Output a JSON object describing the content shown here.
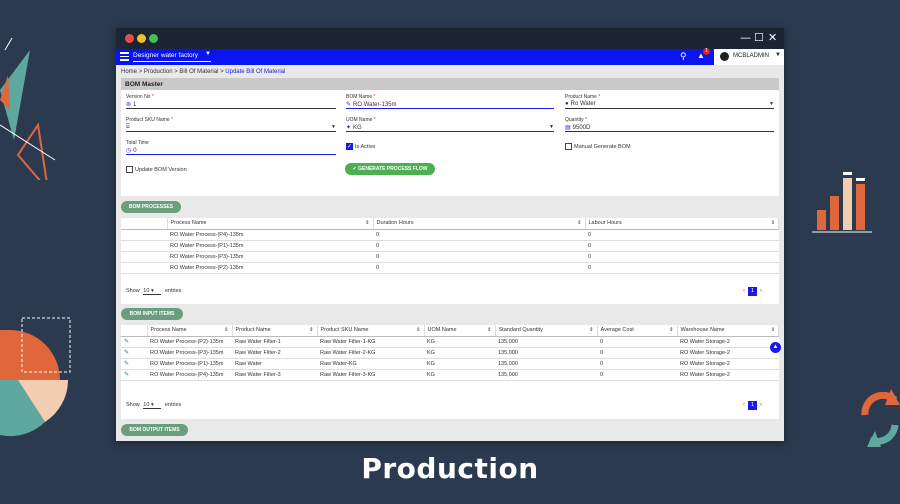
{
  "caption": "Production",
  "app": {
    "company_select": "Designer water factory",
    "notification_count": "1",
    "user_name": "MCBLADMIN"
  },
  "breadcrumb": {
    "home": "Home",
    "sep": ">",
    "production": "Production",
    "bom": "Bill Of Material",
    "current": "Update Bill Of Material"
  },
  "bom_master": {
    "title": "BOM Master",
    "version_no": {
      "label": "Version No",
      "value": "1"
    },
    "bom_name": {
      "label": "BOM Name",
      "value": "RO Water-135m"
    },
    "product_name": {
      "label": "Product Name",
      "value": "Ro Water"
    },
    "product_sku": {
      "label": "Product SKU Name",
      "value": ""
    },
    "uom_name": {
      "label": "UOM Name",
      "value": "KG"
    },
    "quantity": {
      "label": "Quantity",
      "value": "9500D"
    },
    "total_time": {
      "label": "Total Time",
      "value": "0"
    },
    "is_active": "Is Active",
    "manual_generate": "Manual Generate BOM",
    "update_version": "Update BOM Version",
    "generate_button": "GENERATE PROCESS FLOW"
  },
  "bom_processes": {
    "button": "BOM PROCESSES",
    "headers": [
      "Process Name",
      "Duration Hours",
      "Labour Hours"
    ],
    "rows": [
      [
        "RO Water Process-(P4)-135m",
        "0",
        "0"
      ],
      [
        "RO Water Process-(P1)-135m",
        "0",
        "0"
      ],
      [
        "RO Water Process-(P3)-135m",
        "0",
        "0"
      ],
      [
        "RO Water Process-(P2)-135m",
        "0",
        "0"
      ]
    ],
    "show": "Show",
    "entries_value": "10",
    "entries": "entries",
    "page": "1"
  },
  "bom_input": {
    "button": "BOM INPUT ITEMS",
    "headers": [
      "Process Name",
      "Product Name",
      "Product SKU Name",
      "UOM Name",
      "Standard Quantity",
      "Average Cost",
      "Warehouse Name"
    ],
    "rows": [
      [
        "RO Water Process-(P2)-135m",
        "Raw Water Filter-1",
        "Raw Water Filter-1-KG",
        "KG",
        "135,000",
        "0",
        "RO Water Storage-2"
      ],
      [
        "RO Water Process-(P3)-135m",
        "Raw Water Filter-2",
        "Raw Water Filter-2-KG",
        "KG",
        "135,000",
        "0",
        "RO Water Storage-2"
      ],
      [
        "RO Water Process-(P1)-135m",
        "Raw Water",
        "Raw Water-KG",
        "KG",
        "135,000",
        "0",
        "RO Water Storage-2"
      ],
      [
        "RO Water Process-(P4)-135m",
        "Raw Water Filter-3",
        "Raw Water Filter-3-KG",
        "KG",
        "135,000",
        "0",
        "RO Water Storage-2"
      ]
    ],
    "show": "Show",
    "entries_value": "10",
    "entries": "entries",
    "page": "1"
  },
  "bom_output": {
    "button": "BOM OUTPUT ITEMS"
  },
  "colors": {
    "appbar": "#0a14f0",
    "accent": "#1a1ae8",
    "green": "#4caf50",
    "background": "#2b3a4f"
  }
}
